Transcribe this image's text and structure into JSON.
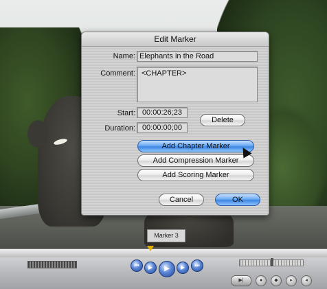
{
  "dialog": {
    "title": "Edit Marker",
    "name_label": "Name:",
    "name_value": "Elephants in the Road",
    "comment_label": "Comment:",
    "comment_value": "<CHAPTER>",
    "start_label": "Start:",
    "start_value": "00:00:26;23",
    "duration_label": "Duration:",
    "duration_value": "00:00:00;00",
    "delete_label": "Delete",
    "add_chapter_label": "Add Chapter Marker",
    "add_compression_label": "Add Compression Marker",
    "add_scoring_label": "Add Scoring Marker",
    "cancel_label": "Cancel",
    "ok_label": "OK"
  },
  "marker_overlay": "Marker 3",
  "colors": {
    "accent": "#3f86e3",
    "dialog_bg": "#cbcbcb",
    "playhead": "#e0b000"
  }
}
